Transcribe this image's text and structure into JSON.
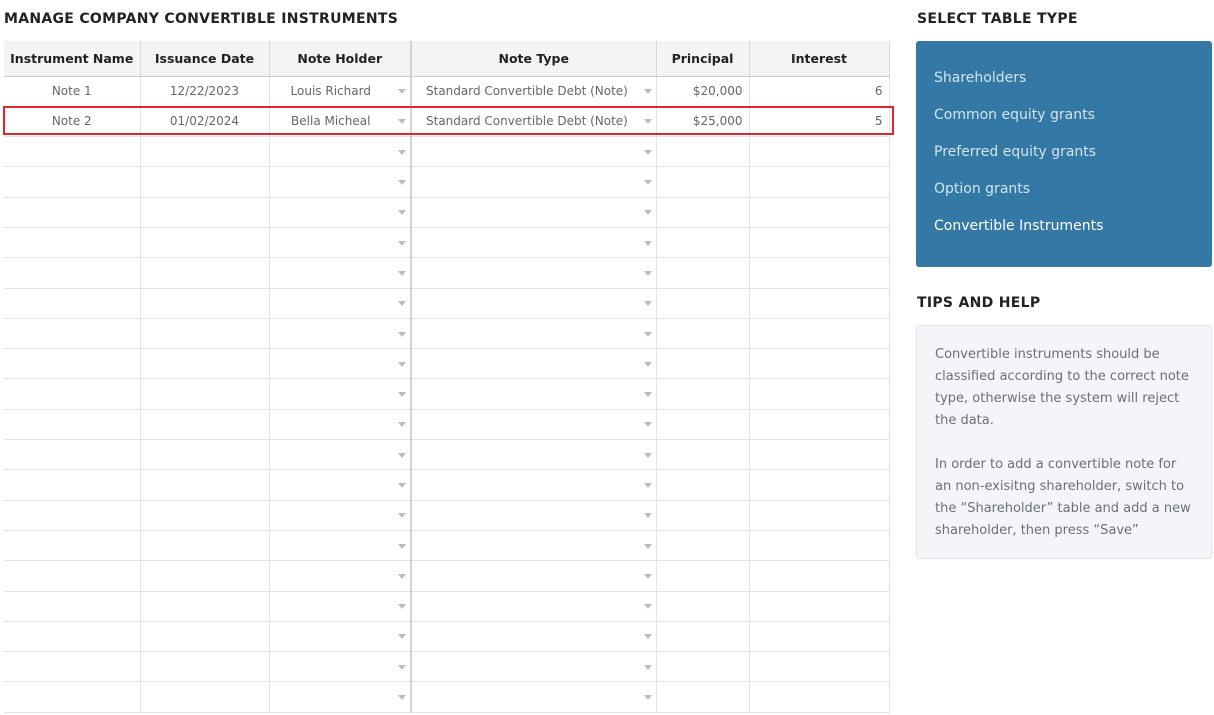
{
  "main": {
    "title": "MANAGE COMPANY CONVERTIBLE INSTRUMENTS",
    "columns": [
      "Instrument Name",
      "Issuance Date",
      "Note Holder",
      "Note Type",
      "Principal",
      "Interest"
    ],
    "rows": [
      {
        "name": "Note 1",
        "date": "12/22/2023",
        "holder": "Louis Richard",
        "type": "Standard Convertible Debt (Note)",
        "principal": "$20,000",
        "interest": "6"
      },
      {
        "name": "Note 2",
        "date": "01/02/2024",
        "holder": "Bella Micheal",
        "type": "Standard Convertible Debt (Note)",
        "principal": "$25,000",
        "interest": "5"
      }
    ],
    "empty_row_count": 19,
    "highlight_color": "#e0252b"
  },
  "table_type": {
    "title": "SELECT TABLE TYPE",
    "items": [
      "Shareholders",
      "Common equity grants",
      "Preferred equity grants",
      "Option grants",
      "Convertible Instruments"
    ],
    "active_index": 4,
    "panel_color": "#3479a5"
  },
  "tips": {
    "title": "TIPS AND HELP",
    "paragraphs": [
      "Convertible instruments should be classified according to the correct note type, otherwise the system will reject the data.",
      "In order to add a convertible note for an non-exisitng shareholder, switch to the “Shareholder” table and add a new shareholder, then press “Save”"
    ]
  },
  "icons": {
    "dropdown": "chevron-down-icon"
  }
}
